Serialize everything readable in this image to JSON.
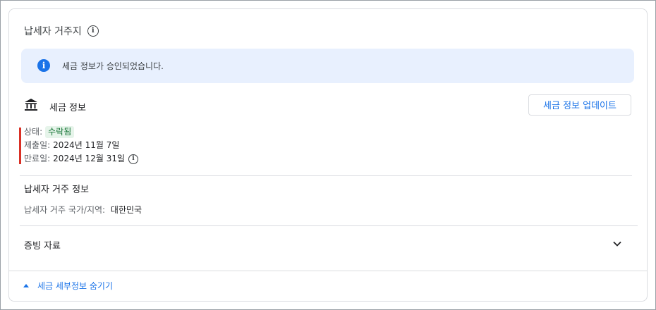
{
  "header": {
    "title": "납세자 거주지",
    "info_icon": "info-outline-icon"
  },
  "banner": {
    "icon": "info-filled-icon",
    "text": "세금 정보가 승인되었습니다."
  },
  "tax_info": {
    "icon": "bank-icon",
    "title": "세금 정보",
    "update_button": "세금 정보 업데이트",
    "status_label": "상태:",
    "status_value": "수락됨",
    "submitted_label": "제출일:",
    "submitted_value": "2024년 11월 7일",
    "expiry_label": "만료일:",
    "expiry_value": "2024년 12월 31일"
  },
  "residence": {
    "title": "납세자 거주 정보",
    "country_label": "납세자 거주 국가/지역:",
    "country_value": "대한민국"
  },
  "evidence": {
    "title": "증빙 자료",
    "icon": "chevron-down-icon"
  },
  "footer": {
    "hide_details": "세금 세부정보 숨기기",
    "icon": "caret-up-icon"
  },
  "colors": {
    "accent": "#1a73e8",
    "banner_bg": "#e8f0fe",
    "status_green": "#137333",
    "marker_red": "#d93025"
  }
}
